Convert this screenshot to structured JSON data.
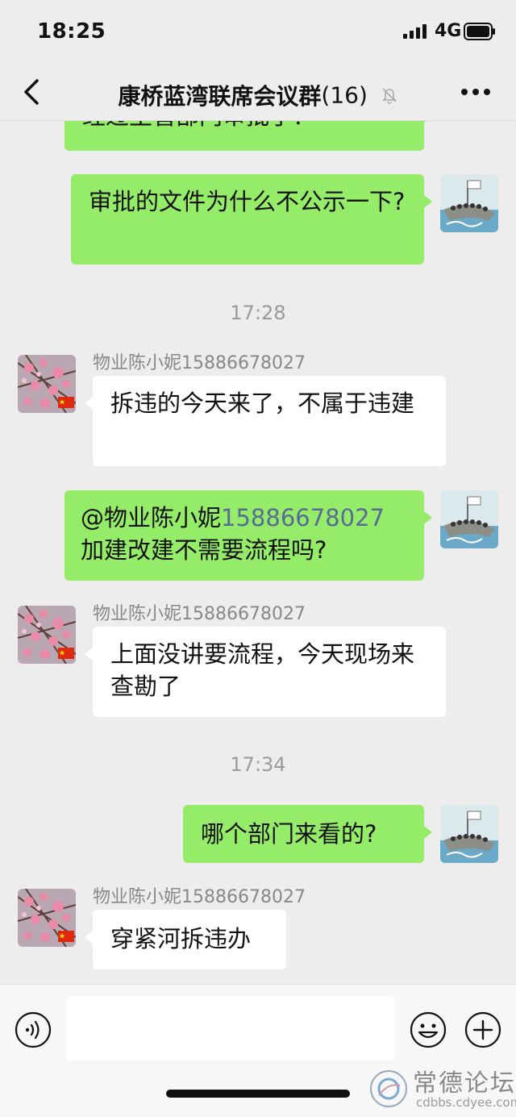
{
  "status_bar": {
    "time": "18:25",
    "network": "4G"
  },
  "nav": {
    "title": "康桥蓝湾联席会议群",
    "member_count": "(16)",
    "icons": [
      "back-icon",
      "mute-icon",
      "more-icon"
    ]
  },
  "messages": [
    {
      "side": "me",
      "text": "经过主管部门审批了？"
    },
    {
      "side": "me",
      "text": "审批的文件为什么不公示一下?"
    },
    {
      "type": "time",
      "text": "17:28"
    },
    {
      "side": "other",
      "sender": "物业陈小妮15886678027",
      "text": "拆违的今天来了，不属于违建"
    },
    {
      "side": "me",
      "mention_name": "@物业陈小妮",
      "mention_phone": "15886678027",
      "text": "加建改建不需要流程吗?"
    },
    {
      "side": "other",
      "sender": "物业陈小妮15886678027",
      "text": "上面没讲要流程，今天现场来查勘了"
    },
    {
      "type": "time",
      "text": "17:34"
    },
    {
      "side": "me",
      "text": "哪个部门来看的?"
    },
    {
      "side": "other",
      "sender": "物业陈小妮15886678027",
      "text": "穿紧河拆违办"
    }
  ],
  "input_bar": {
    "placeholder": "",
    "icons": [
      "voice-icon",
      "emoji-icon",
      "plus-icon"
    ]
  },
  "watermark": {
    "text": "常德论坛",
    "url": "cdbbs.cdyee.com"
  },
  "colors": {
    "my_bubble": "#95ec69",
    "other_bubble": "#ffffff",
    "background": "#ededed",
    "link": "#576b95"
  }
}
